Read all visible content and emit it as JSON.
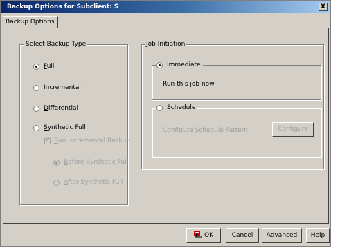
{
  "window": {
    "title": "Backup Options for Subclient: S",
    "close_label": "X"
  },
  "tab": {
    "label": "Backup Options"
  },
  "select_backup_type": {
    "legend": "Select Backup Type",
    "full": "Full",
    "incremental": "Incremental",
    "differential": "Differential",
    "synthetic_full": "Synthetic Full",
    "run_incremental": "Run Incremental Backup",
    "before_synthetic": "Before Synthetic Full",
    "after_synthetic": "After Synthetic Full"
  },
  "job_initiation": {
    "legend": "Job Initiation",
    "immediate": "Immediate",
    "run_now": "Run this job now",
    "schedule": "Schedule",
    "configure_pattern": "Configure Schedule Pattern",
    "configure_button": "Configure"
  },
  "buttons": {
    "ok": "OK",
    "cancel": "Cancel",
    "advanced": "Advanced",
    "help": "Help"
  }
}
